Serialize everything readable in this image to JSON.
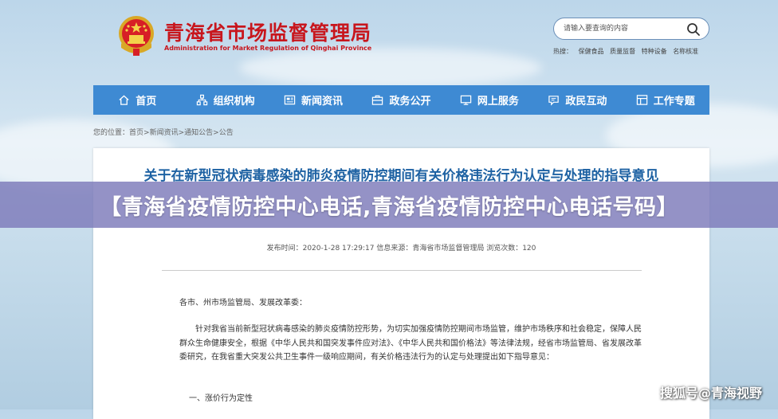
{
  "header": {
    "site_title_cn": "青海省市场监督管理局",
    "site_title_en": "Administration for Market Regulation of Qinghai Province",
    "search": {
      "placeholder": "请输入要查询的内容"
    },
    "hot_label": "热搜：",
    "hot_links": [
      "保健食品",
      "质量监督",
      "特种设备",
      "名称核准"
    ]
  },
  "nav": {
    "items": [
      {
        "label": "首页",
        "icon": "home-icon"
      },
      {
        "label": "组织机构",
        "icon": "org-chart-icon"
      },
      {
        "label": "新闻资讯",
        "icon": "news-icon"
      },
      {
        "label": "政务公开",
        "icon": "briefcase-icon"
      },
      {
        "label": "网上服务",
        "icon": "monitor-icon"
      },
      {
        "label": "政民互动",
        "icon": "chat-icon"
      },
      {
        "label": "工作专题",
        "icon": "topic-icon"
      }
    ]
  },
  "breadcrumb": {
    "prefix": "您的位置：",
    "items": [
      "首页",
      "新闻资讯",
      "通知公告",
      "公告"
    ]
  },
  "article": {
    "title": "关于在新型冠状病毒感染的肺炎疫情防控期间有关价格违法行为认定与处理的指导意见",
    "meta": "发布时间：2020-1-28 17:29:17 信息来源：青海省市场监督管理局 浏览次数：120",
    "salutation": "各市、州市场监管局、发展改革委：",
    "paragraph1": "针对我省当前新型冠状病毒感染的肺炎疫情防控形势，为切实加强疫情防控期间市场监管，维护市场秩序和社会稳定，保障人民群众生命健康安全，根据《中华人民共和国突发事件应对法》、《中华人民共和国价格法》等法律法规，经省市场监管局、省发展改革委研究，在我省重大突发公共卫生事件一级响应期间，有关价格违法行为的认定与处理提出如下指导意见：",
    "section1": "一、涨价行为定性"
  },
  "banner": {
    "text": "【青海省疫情防控中心电话,青海省疫情防控中心电话号码】"
  },
  "watermark": {
    "text": "搜狐号@青海视野"
  },
  "colors": {
    "brand_red": "#c8161d",
    "nav_blue": "#3e8ad3",
    "title_blue": "#1e62a3",
    "banner": "#7c7aba"
  }
}
